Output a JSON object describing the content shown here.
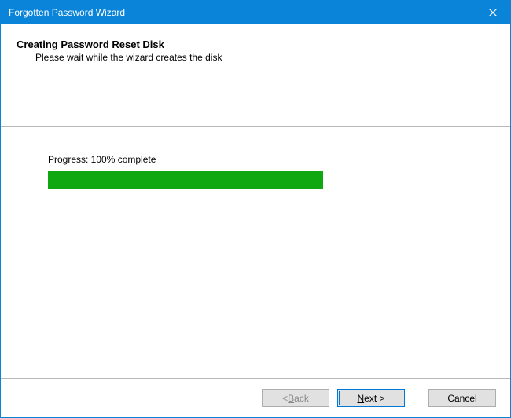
{
  "window": {
    "title": "Forgotten Password Wizard"
  },
  "header": {
    "heading": "Creating Password Reset Disk",
    "subheading": "Please wait while the wizard creates the disk"
  },
  "content": {
    "progress_label": "Progress: 100% complete",
    "progress_percent": 100
  },
  "buttons": {
    "back_prefix": "< ",
    "back_char": "B",
    "back_suffix": "ack",
    "next_char": "N",
    "next_suffix": "ext >",
    "cancel": "Cancel",
    "back_enabled": false,
    "next_enabled": true,
    "cancel_enabled": true
  },
  "colors": {
    "titlebar": "#0a84d8",
    "progress": "#10a810"
  }
}
